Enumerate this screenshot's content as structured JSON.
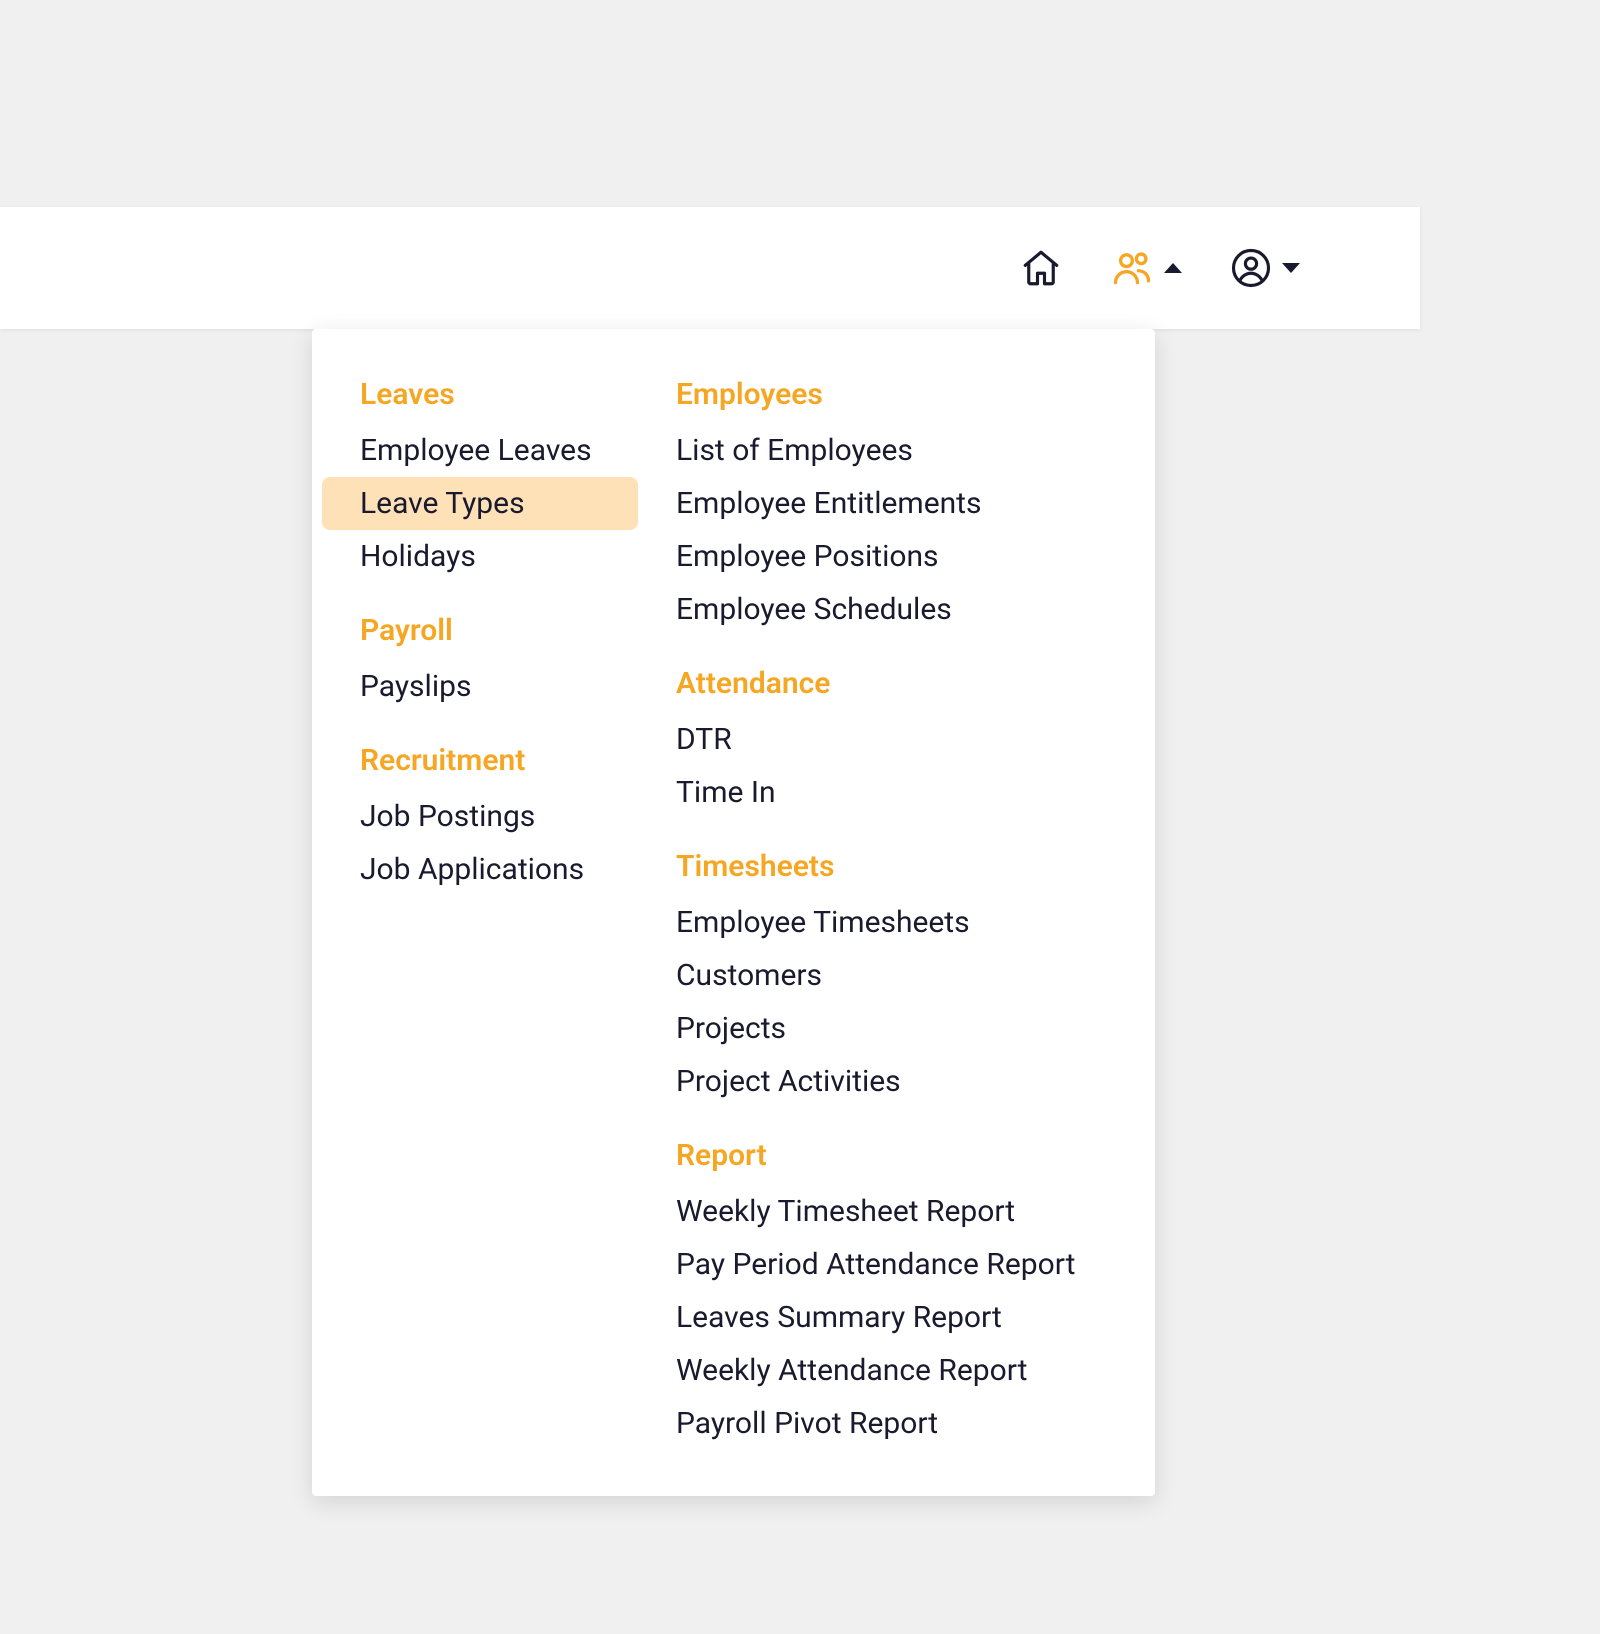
{
  "colors": {
    "accent": "#f5a623",
    "highlight": "#ffe1b8",
    "text": "#1a1a2e"
  },
  "topbar": {
    "home_icon": "home-icon",
    "people_icon": "people-icon",
    "user_icon": "user-icon"
  },
  "menu": {
    "col1": [
      {
        "title": "Leaves",
        "items": [
          {
            "label": "Employee Leaves",
            "active": false
          },
          {
            "label": "Leave Types",
            "active": true
          },
          {
            "label": "Holidays",
            "active": false
          }
        ]
      },
      {
        "title": "Payroll",
        "items": [
          {
            "label": "Payslips",
            "active": false
          }
        ]
      },
      {
        "title": "Recruitment",
        "items": [
          {
            "label": "Job Postings",
            "active": false
          },
          {
            "label": "Job Applications",
            "active": false
          }
        ]
      }
    ],
    "col2": [
      {
        "title": "Employees",
        "items": [
          {
            "label": "List of Employees",
            "active": false
          },
          {
            "label": "Employee Entitlements",
            "active": false
          },
          {
            "label": "Employee Positions",
            "active": false
          },
          {
            "label": "Employee Schedules",
            "active": false
          }
        ]
      },
      {
        "title": "Attendance",
        "items": [
          {
            "label": "DTR",
            "active": false
          },
          {
            "label": "Time In",
            "active": false
          }
        ]
      },
      {
        "title": "Timesheets",
        "items": [
          {
            "label": "Employee Timesheets",
            "active": false
          },
          {
            "label": "Customers",
            "active": false
          },
          {
            "label": "Projects",
            "active": false
          },
          {
            "label": "Project Activities",
            "active": false
          }
        ]
      },
      {
        "title": "Report",
        "items": [
          {
            "label": "Weekly Timesheet Report",
            "active": false
          },
          {
            "label": "Pay Period Attendance Report",
            "active": false
          },
          {
            "label": "Leaves Summary Report",
            "active": false
          },
          {
            "label": "Weekly Attendance Report",
            "active": false
          },
          {
            "label": "Payroll Pivot Report",
            "active": false
          }
        ]
      }
    ]
  }
}
